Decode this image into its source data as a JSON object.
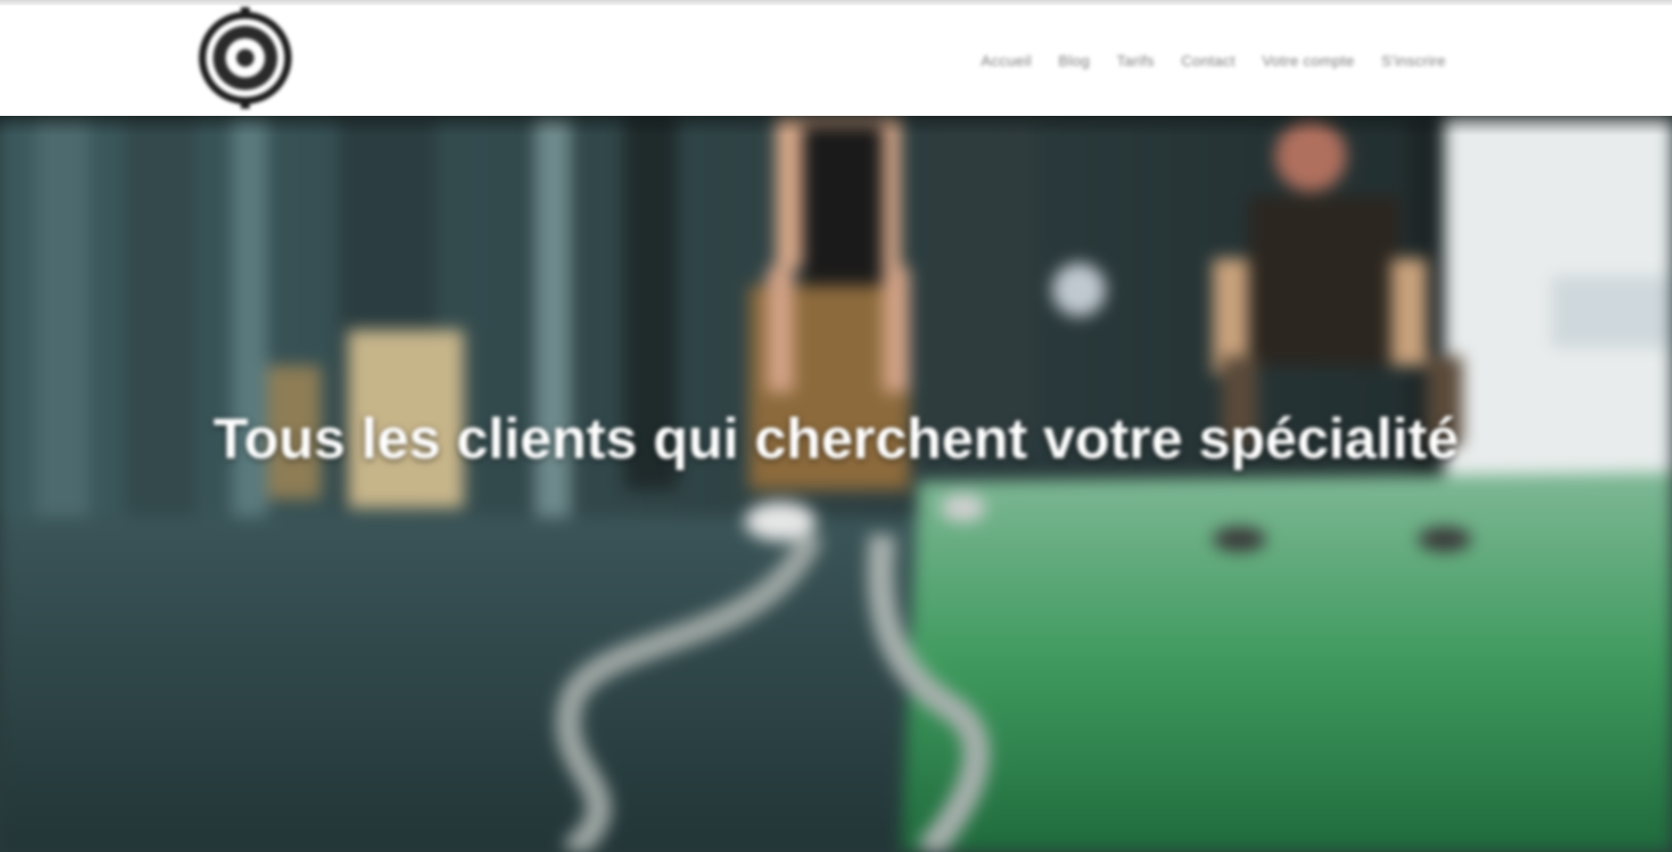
{
  "brand": {
    "logo_icon": "circle-target-logo-icon"
  },
  "nav": {
    "items": [
      {
        "label": "Accueil"
      },
      {
        "label": "Blog"
      },
      {
        "label": "Tarifs"
      },
      {
        "label": "Contact"
      },
      {
        "label": "Votre compte"
      },
      {
        "label": "S'inscrire"
      }
    ]
  },
  "hero": {
    "title": "Tous les clients qui cherchent votre spécialité",
    "background_image": "gym-battle-ropes-photo"
  },
  "colors": {
    "header_bg": "#ffffff",
    "nav_text": "#7a7a7a",
    "title_text": "#ffffff",
    "turf_green": "#3f9a5e",
    "floor_teal": "#2e4a4e"
  }
}
